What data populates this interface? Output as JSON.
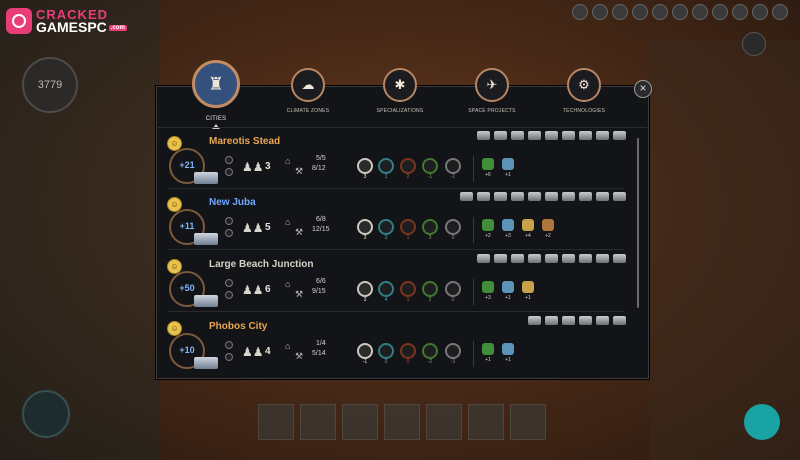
{
  "watermark": {
    "line1": "CRACKED",
    "line2": "GAMESPC",
    "badge": ".com"
  },
  "hud": {
    "resource_counter": "3779"
  },
  "tabs": [
    {
      "label": "CITIES",
      "icon": "cities-icon",
      "active": true
    },
    {
      "label": "CLIMATE ZONES",
      "icon": "climate-zones-icon",
      "active": false
    },
    {
      "label": "SPECIALIZATIONS",
      "icon": "specializations-icon",
      "active": false
    },
    {
      "label": "SPACE PROJECTS",
      "icon": "space-projects-icon",
      "active": false
    },
    {
      "label": "TECHNOLOGIES",
      "icon": "technologies-icon",
      "active": false
    }
  ],
  "cities": [
    {
      "name": "Mareotis Stead",
      "name_color": "#e8a852",
      "happiness": "+21",
      "population": "3",
      "housing": "5/5",
      "jobs": "8/12",
      "resources": [
        "3",
        "1",
        "2",
        "-1",
        "-1"
      ],
      "bonuses": [
        "+6",
        "+1"
      ]
    },
    {
      "name": "New Juba",
      "name_color": "#6fa8ff",
      "happiness": "+11",
      "population": "5",
      "housing": "6/8",
      "jobs": "12/15",
      "resources": [
        "3",
        "3",
        "1",
        "3",
        "0"
      ],
      "bonuses": [
        "+2",
        "+3",
        "+4",
        "+2"
      ]
    },
    {
      "name": "Large Beach Junction",
      "name_color": "#d6d2c8",
      "happiness": "+50",
      "population": "6",
      "housing": "6/6",
      "jobs": "9/15",
      "resources": [
        "3",
        "4",
        "1",
        "2",
        "0"
      ],
      "bonuses": [
        "+3",
        "+1",
        "+1"
      ]
    },
    {
      "name": "Phobos City",
      "name_color": "#e8a852",
      "happiness": "+10",
      "population": "4",
      "housing": "1/4",
      "jobs": "5/14",
      "resources": [
        "-1",
        "0",
        "0",
        "-2",
        "-3"
      ],
      "bonuses": [
        "+1",
        "+1"
      ]
    }
  ],
  "colors": {
    "accent_orange": "#e8a852",
    "accent_blue": "#6fa8ff",
    "panel_bg": "#121418"
  }
}
